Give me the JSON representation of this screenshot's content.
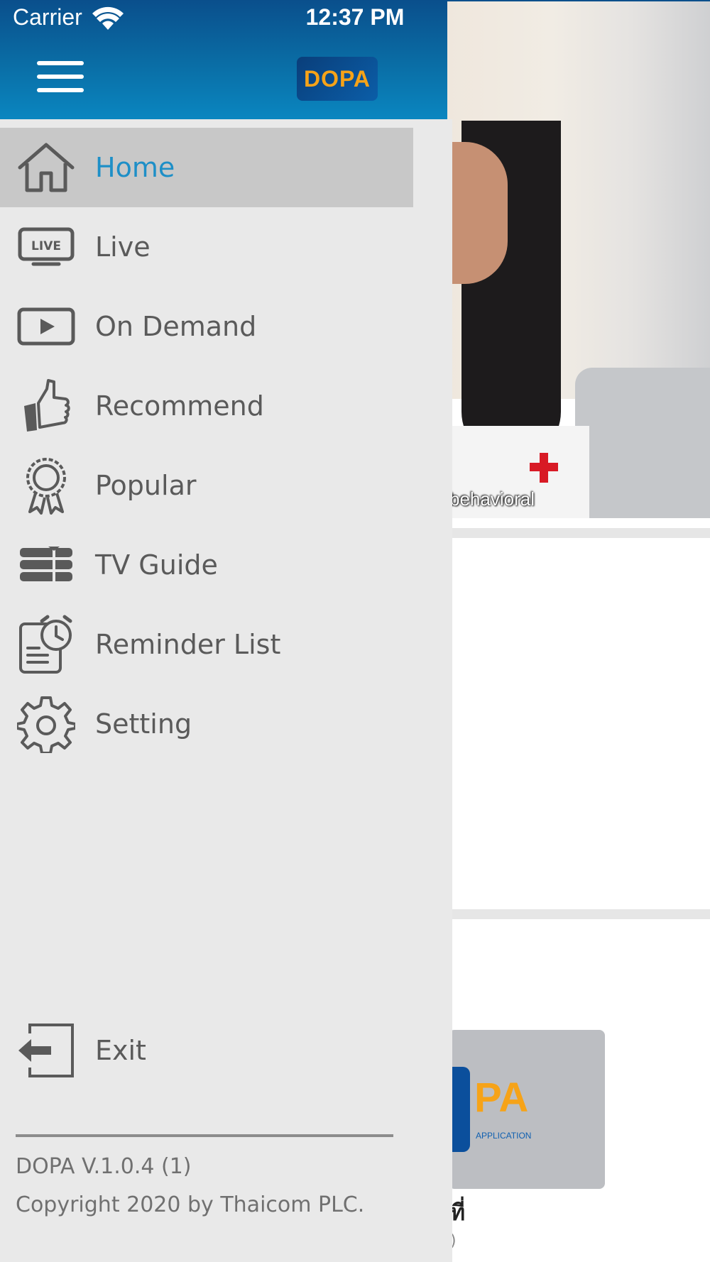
{
  "status_bar": {
    "carrier": "Carrier",
    "time": "12:37 PM",
    "wifi_icon": "wifi-icon",
    "battery_icon": "battery-charging-icon"
  },
  "header": {
    "logo_text": "DOPA",
    "menu_icon": "hamburger-menu-icon",
    "toggle_state": "off",
    "brand_color": "#0a6ea6"
  },
  "drawer": {
    "items": [
      {
        "label": "Home",
        "icon": "home-icon",
        "active": true
      },
      {
        "label": "Live",
        "icon": "live-tv-icon",
        "active": false
      },
      {
        "label": "On Demand",
        "icon": "play-icon",
        "active": false
      },
      {
        "label": "Recommend",
        "icon": "thumbs-up-icon",
        "active": false
      },
      {
        "label": "Popular",
        "icon": "award-ribbon-icon",
        "active": false
      },
      {
        "label": "TV Guide",
        "icon": "tv-guide-icon",
        "active": false
      },
      {
        "label": "Reminder List",
        "icon": "reminder-clock-icon",
        "active": false
      },
      {
        "label": "Setting",
        "icon": "gear-icon",
        "active": false
      }
    ],
    "exit": {
      "label": "Exit",
      "icon": "exit-icon"
    },
    "version": "DOPA V.1.0.4 (1)",
    "copyright": "Copyright 2020 by Thaicom PLC.",
    "active_color": "#1e8fc7"
  },
  "background": {
    "video_subtitle": "behavioral",
    "card_logo": "PA",
    "card_app_label": "APPLICATION",
    "card_title": "ที่",
    "card_sub": ")"
  }
}
